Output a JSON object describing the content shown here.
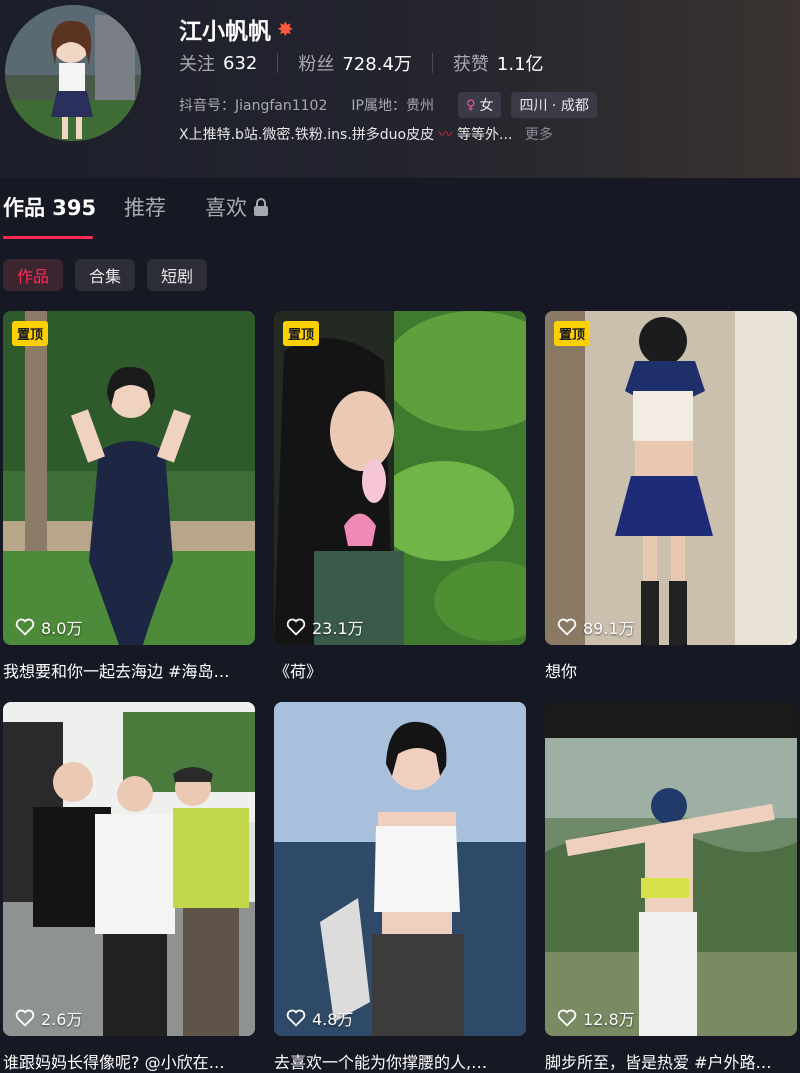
{
  "profile": {
    "name": "江小帆帆",
    "stats": [
      {
        "label": "关注",
        "value": "632"
      },
      {
        "label": "粉丝",
        "value": "728.4万"
      },
      {
        "label": "获赞",
        "value": "1.1亿"
      }
    ],
    "douyin_id": "抖音号：Jiangfan1102",
    "ip_location": "IP属地：贵州",
    "gender": "女",
    "region": "四川 · 成都",
    "bio": "X上推特.b站.微密.铁粉.ins.拼多duo皮皮",
    "bio_tail": "等等外...",
    "more_label": "更多"
  },
  "tabs": [
    {
      "label": "作品 395"
    },
    {
      "label": "推荐"
    },
    {
      "label": "喜欢"
    }
  ],
  "subtabs": [
    {
      "label": "作品"
    },
    {
      "label": "合集"
    },
    {
      "label": "短剧"
    }
  ],
  "pin_label": "置顶",
  "videos": [
    {
      "likes": "8.0万",
      "caption": "我想要和你一起去海边 #海岛…",
      "pinned": true
    },
    {
      "likes": "23.1万",
      "caption": "《荷》",
      "pinned": true
    },
    {
      "likes": "89.1万",
      "caption": "想你",
      "pinned": true
    },
    {
      "likes": "2.6万",
      "caption": "谁跟妈妈长得像呢? @小欣在…",
      "pinned": false
    },
    {
      "likes": "4.8万",
      "caption": "去喜欢一个能为你撑腰的人,…",
      "pinned": false
    },
    {
      "likes": "12.8万",
      "caption": "脚步所至，皆是热爱 #户外路…",
      "pinned": false
    }
  ],
  "colors": {
    "accent": "#fe2c55",
    "pin": "#fdd100",
    "background": "#161823"
  }
}
